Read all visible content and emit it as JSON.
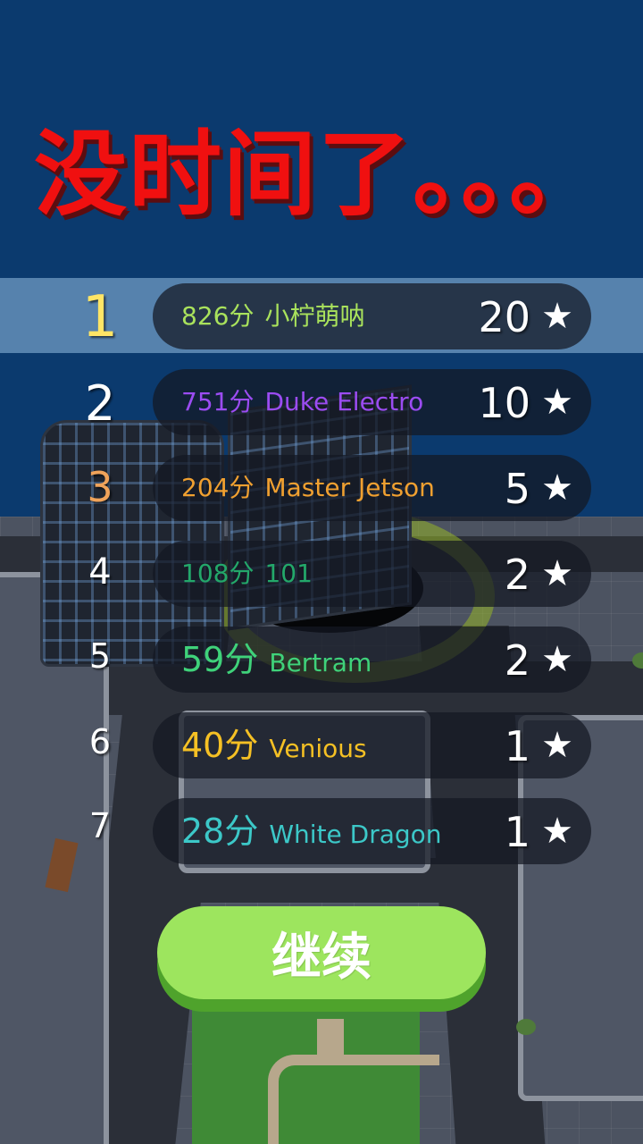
{
  "title": "没时间了。。。",
  "leaderboard": [
    {
      "rank": "1",
      "score": "826分",
      "name": "小柠萌呐",
      "stars": "20",
      "rank_color": "#ffe566",
      "text_color": "#a9e25c",
      "highlighted": true
    },
    {
      "rank": "2",
      "score": "751分",
      "name": "Duke Electro",
      "stars": "10",
      "rank_color": "#ffffff",
      "text_color": "#9b4cf2",
      "highlighted": false
    },
    {
      "rank": "3",
      "score": "204分",
      "name": "Master Jetson",
      "stars": "5",
      "rank_color": "#f0a35a",
      "text_color": "#f0a030",
      "highlighted": false
    },
    {
      "rank": "4",
      "score": "108分",
      "name": "101",
      "stars": "2",
      "rank_color": "#ffffff",
      "text_color": "#23a86a",
      "highlighted": false
    },
    {
      "rank": "5",
      "score": "59分",
      "name": "Bertram",
      "stars": "2",
      "rank_color": "#ffffff",
      "text_color": "#3fd27a",
      "highlighted": false
    },
    {
      "rank": "6",
      "score": "40分",
      "name": "Venious",
      "stars": "1",
      "rank_color": "#ffffff",
      "text_color": "#f5c024",
      "highlighted": false
    },
    {
      "rank": "7",
      "score": "28分",
      "name": "White Dragon",
      "stars": "1",
      "rank_color": "#ffffff",
      "text_color": "#3cc8c8",
      "highlighted": false
    }
  ],
  "star_icon": "star-icon",
  "star_glyph": "★",
  "continue_label": "继续"
}
